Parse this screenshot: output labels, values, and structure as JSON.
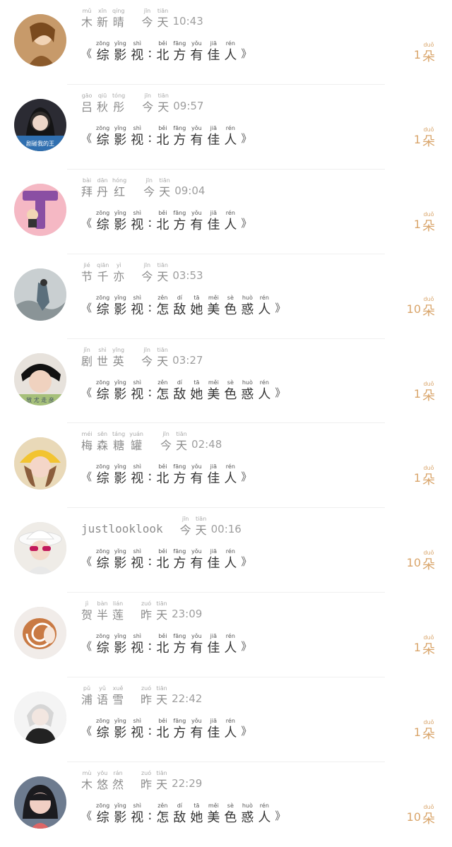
{
  "colors": {
    "accent": "#d9a56b",
    "text": "#333333",
    "muted": "#9a9a9a"
  },
  "pinyin": {
    "jin": "jīn",
    "tian": "tiān",
    "zuo": "zuó",
    "duo": "duǒ"
  },
  "feed": [
    {
      "avatar": "avatar-warm-portrait",
      "name": [
        [
          "mǔ",
          "木"
        ],
        [
          "xīn",
          "新"
        ],
        [
          "qíng",
          "晴"
        ]
      ],
      "day": [
        [
          "jīn",
          "今"
        ],
        [
          "tiān",
          "天"
        ]
      ],
      "time": "10:43",
      "book": [
        [
          "zōng",
          "综"
        ],
        [
          "yǐng",
          "影"
        ],
        [
          "shì",
          "视"
        ],
        [
          ":",
          ""
        ],
        [
          "běi",
          "北"
        ],
        [
          "fāng",
          "方"
        ],
        [
          "yǒu",
          "有"
        ],
        [
          "jiā",
          "佳"
        ],
        [
          "rén",
          "人"
        ]
      ],
      "count": "1",
      "unit": [
        [
          "duǒ",
          "朵"
        ]
      ]
    },
    {
      "avatar": "avatar-dark-hair",
      "name": [
        [
          "gāo",
          "吕"
        ],
        [
          "qiū",
          "秋"
        ],
        [
          "tóng",
          "彤"
        ]
      ],
      "day": [
        [
          "jīn",
          "今"
        ],
        [
          "tiān",
          "天"
        ]
      ],
      "time": "09:57",
      "book": [
        [
          "zōng",
          "综"
        ],
        [
          "yǐng",
          "影"
        ],
        [
          "shì",
          "视"
        ],
        [
          ":",
          ""
        ],
        [
          "běi",
          "北"
        ],
        [
          "fāng",
          "方"
        ],
        [
          "yǒu",
          "有"
        ],
        [
          "jiā",
          "佳"
        ],
        [
          "rén",
          "人"
        ]
      ],
      "count": "1",
      "unit": [
        [
          "duǒ",
          "朵"
        ]
      ]
    },
    {
      "avatar": "avatar-letter-t",
      "name": [
        [
          "bài",
          "拜"
        ],
        [
          "dān",
          "丹"
        ],
        [
          "hóng",
          "红"
        ]
      ],
      "day": [
        [
          "jīn",
          "今"
        ],
        [
          "tiān",
          "天"
        ]
      ],
      "time": "09:04",
      "book": [
        [
          "zōng",
          "综"
        ],
        [
          "yǐng",
          "影"
        ],
        [
          "shì",
          "视"
        ],
        [
          ":",
          ""
        ],
        [
          "běi",
          "北"
        ],
        [
          "fāng",
          "方"
        ],
        [
          "yǒu",
          "有"
        ],
        [
          "jiā",
          "佳"
        ],
        [
          "rén",
          "人"
        ]
      ],
      "count": "1",
      "unit": [
        [
          "duǒ",
          "朵"
        ]
      ]
    },
    {
      "avatar": "avatar-ink-painting",
      "name": [
        [
          "jié",
          "节"
        ],
        [
          "qiān",
          "千"
        ],
        [
          "yì",
          "亦"
        ]
      ],
      "day": [
        [
          "jīn",
          "今"
        ],
        [
          "tiān",
          "天"
        ]
      ],
      "time": "03:53",
      "book": [
        [
          "zōng",
          "综"
        ],
        [
          "yǐng",
          "影"
        ],
        [
          "shì",
          "视"
        ],
        [
          ":",
          ""
        ],
        [
          "zěn",
          "怎"
        ],
        [
          "dí",
          "敌"
        ],
        [
          "tā",
          "她"
        ],
        [
          "měi",
          "美"
        ],
        [
          "sè",
          "色"
        ],
        [
          "huò",
          "惑"
        ],
        [
          "rén",
          "人"
        ]
      ],
      "count": "10",
      "unit": [
        [
          "duǒ",
          "朵"
        ]
      ]
    },
    {
      "avatar": "avatar-boy-green",
      "name": [
        [
          "jǐn",
          "剧"
        ],
        [
          "shì",
          "世"
        ],
        [
          "yīng",
          "英"
        ]
      ],
      "day": [
        [
          "jīn",
          "今"
        ],
        [
          "tiān",
          "天"
        ]
      ],
      "time": "03:27",
      "book": [
        [
          "zōng",
          "综"
        ],
        [
          "yǐng",
          "影"
        ],
        [
          "shì",
          "视"
        ],
        [
          ":",
          ""
        ],
        [
          "zěn",
          "怎"
        ],
        [
          "dí",
          "敌"
        ],
        [
          "tā",
          "她"
        ],
        [
          "měi",
          "美"
        ],
        [
          "sè",
          "色"
        ],
        [
          "huò",
          "惑"
        ],
        [
          "rén",
          "人"
        ]
      ],
      "count": "1",
      "unit": [
        [
          "duǒ",
          "朵"
        ]
      ]
    },
    {
      "avatar": "avatar-yellow-hat",
      "name": [
        [
          "méi",
          "梅"
        ],
        [
          "sēn",
          "森"
        ],
        [
          "táng",
          "糖"
        ],
        [
          "yuán",
          "罐"
        ]
      ],
      "day": [
        [
          "jīn",
          "今"
        ],
        [
          "tiān",
          "天"
        ]
      ],
      "time": "02:48",
      "book": [
        [
          "zōng",
          "综"
        ],
        [
          "yǐng",
          "影"
        ],
        [
          "shì",
          "视"
        ],
        [
          ":",
          ""
        ],
        [
          "běi",
          "北"
        ],
        [
          "fāng",
          "方"
        ],
        [
          "yǒu",
          "有"
        ],
        [
          "jiā",
          "佳"
        ],
        [
          "rén",
          "人"
        ]
      ],
      "count": "1",
      "unit": [
        [
          "duǒ",
          "朵"
        ]
      ]
    },
    {
      "avatar": "avatar-sunglasses-hat",
      "name_text": "justlooklook",
      "day": [
        [
          "jīn",
          "今"
        ],
        [
          "tiān",
          "天"
        ]
      ],
      "time": "00:16",
      "book": [
        [
          "zōng",
          "综"
        ],
        [
          "yǐng",
          "影"
        ],
        [
          "shì",
          "视"
        ],
        [
          ":",
          ""
        ],
        [
          "běi",
          "北"
        ],
        [
          "fāng",
          "方"
        ],
        [
          "yǒu",
          "有"
        ],
        [
          "jiā",
          "佳"
        ],
        [
          "rén",
          "人"
        ]
      ],
      "count": "10",
      "unit": [
        [
          "duǒ",
          "朵"
        ]
      ]
    },
    {
      "avatar": "avatar-nautilus-shell",
      "name": [
        [
          "jì",
          "贺"
        ],
        [
          "bàn",
          "半"
        ],
        [
          "lián",
          "莲"
        ]
      ],
      "day": [
        [
          "zuó",
          "昨"
        ],
        [
          "tiān",
          "天"
        ]
      ],
      "time": "23:09",
      "book": [
        [
          "zōng",
          "综"
        ],
        [
          "yǐng",
          "影"
        ],
        [
          "shì",
          "视"
        ],
        [
          ":",
          ""
        ],
        [
          "běi",
          "北"
        ],
        [
          "fāng",
          "方"
        ],
        [
          "yǒu",
          "有"
        ],
        [
          "jiā",
          "佳"
        ],
        [
          "rén",
          "人"
        ]
      ],
      "count": "1",
      "unit": [
        [
          "duǒ",
          "朵"
        ]
      ]
    },
    {
      "avatar": "avatar-anime-boy",
      "name": [
        [
          "pǔ",
          "浦"
        ],
        [
          "yǔ",
          "语"
        ],
        [
          "xuě",
          "雪"
        ]
      ],
      "day": [
        [
          "zuó",
          "昨"
        ],
        [
          "tiān",
          "天"
        ]
      ],
      "time": "22:42",
      "book": [
        [
          "zōng",
          "综"
        ],
        [
          "yǐng",
          "影"
        ],
        [
          "shì",
          "视"
        ],
        [
          ":",
          ""
        ],
        [
          "běi",
          "北"
        ],
        [
          "fāng",
          "方"
        ],
        [
          "yǒu",
          "有"
        ],
        [
          "jiā",
          "佳"
        ],
        [
          "rén",
          "人"
        ]
      ],
      "count": "1",
      "unit": [
        [
          "duǒ",
          "朵"
        ]
      ]
    },
    {
      "avatar": "avatar-girl-bangs",
      "name": [
        [
          "mù",
          "木"
        ],
        [
          "yōu",
          "悠"
        ],
        [
          "rán",
          "然"
        ]
      ],
      "day": [
        [
          "zuó",
          "昨"
        ],
        [
          "tiān",
          "天"
        ]
      ],
      "time": "22:29",
      "book": [
        [
          "zōng",
          "综"
        ],
        [
          "yǐng",
          "影"
        ],
        [
          "shì",
          "视"
        ],
        [
          ":",
          ""
        ],
        [
          "zěn",
          "怎"
        ],
        [
          "dí",
          "敌"
        ],
        [
          "tā",
          "她"
        ],
        [
          "měi",
          "美"
        ],
        [
          "sè",
          "色"
        ],
        [
          "huò",
          "惑"
        ],
        [
          "rén",
          "人"
        ]
      ],
      "count": "10",
      "unit": [
        [
          "duǒ",
          "朵"
        ]
      ]
    }
  ],
  "brackets": {
    "open": "《",
    "close": "》",
    "colon": ":"
  }
}
